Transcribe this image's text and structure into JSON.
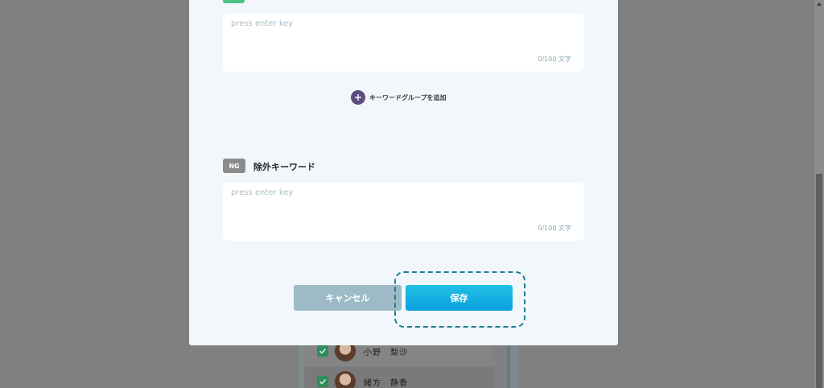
{
  "modal": {
    "keyword_input": {
      "placeholder": "press enter key",
      "counter": "0/100 文字"
    },
    "add_group": {
      "label": "キーワードグループを追加"
    },
    "ng_section": {
      "badge": "NG",
      "title": "除外キーワード",
      "placeholder": "press enter key",
      "counter": "0/100 文字"
    },
    "buttons": {
      "cancel": "キャンセル",
      "save": "保存"
    }
  },
  "background_list": {
    "rows": [
      {
        "name": "小野　梨沙",
        "checked": true
      },
      {
        "name": "緒方　静香",
        "checked": true
      }
    ]
  },
  "colors": {
    "overlay": "#808080",
    "modal_bg": "#f1f7fa",
    "save_gradient_top": "#21c0e6",
    "save_gradient_bottom": "#0aa1de",
    "cancel_bg": "#9dbac6",
    "ng_badge": "#8b8b8b",
    "add_circle": "#5b4b80",
    "keyword_tag": "#4cc286",
    "focus_ring": "#1f7f93"
  }
}
